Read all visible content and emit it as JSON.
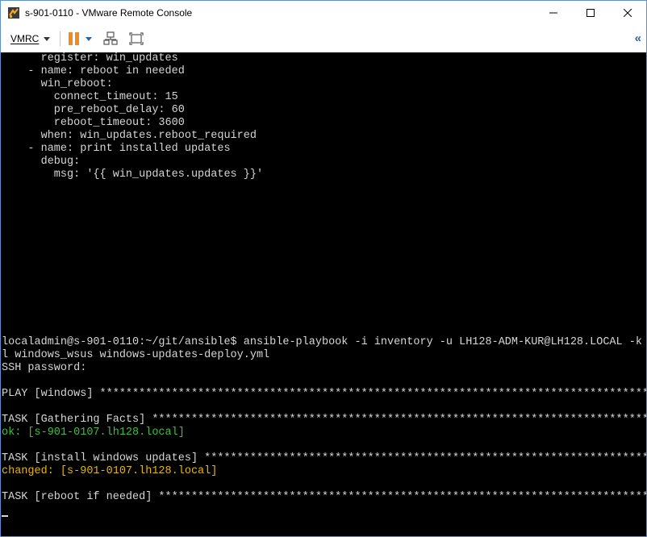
{
  "window": {
    "title": "s-901-0110 - VMware Remote Console",
    "controls": {
      "minimize": "—",
      "maximize": "☐",
      "close": "✕"
    }
  },
  "toolbar": {
    "vmrc_label": "VMRC",
    "collapse_label": "«"
  },
  "console": {
    "lines": [
      {
        "text": "      register: win_updates",
        "color": "default"
      },
      {
        "text": "    - name: reboot in needed",
        "color": "default"
      },
      {
        "text": "      win_reboot:",
        "color": "default"
      },
      {
        "text": "        connect_timeout: 15",
        "color": "default"
      },
      {
        "text": "        pre_reboot_delay: 60",
        "color": "default"
      },
      {
        "text": "        reboot_timeout: 3600",
        "color": "default"
      },
      {
        "text": "      when: win_updates.reboot_required",
        "color": "default"
      },
      {
        "text": "    - name: print installed updates",
        "color": "default"
      },
      {
        "text": "      debug:",
        "color": "default"
      },
      {
        "text": "        msg: '{{ win_updates.updates }}'",
        "color": "default"
      },
      {
        "text": "",
        "color": "default"
      },
      {
        "text": "",
        "color": "default"
      },
      {
        "text": "",
        "color": "default"
      },
      {
        "text": "",
        "color": "default"
      },
      {
        "text": "",
        "color": "default"
      },
      {
        "text": "",
        "color": "default"
      },
      {
        "text": "",
        "color": "default"
      },
      {
        "text": "",
        "color": "default"
      },
      {
        "text": "",
        "color": "default"
      },
      {
        "text": "",
        "color": "default"
      },
      {
        "text": "",
        "color": "default"
      },
      {
        "text": "",
        "color": "default"
      },
      {
        "text": "localadmin@s-901-0110:~/git/ansible$ ansible-playbook -i inventory -u LH128-ADM-KUR@LH128.LOCAL -k -",
        "color": "default"
      },
      {
        "text": "l windows_wsus windows-updates-deploy.yml",
        "color": "default"
      },
      {
        "text": "SSH password:",
        "color": "default"
      },
      {
        "text": "",
        "color": "default"
      },
      {
        "text": "PLAY [windows] ******************************************************************************************",
        "color": "default"
      },
      {
        "text": "",
        "color": "default"
      },
      {
        "text": "TASK [Gathering Facts] **********************************************************************************",
        "color": "default"
      },
      {
        "text": "ok: [s-901-0107.lh128.local]",
        "color": "green"
      },
      {
        "text": "",
        "color": "default"
      },
      {
        "text": "TASK [install windows updates] **************************************************************************",
        "color": "default"
      },
      {
        "text": "changed: [s-901-0107.lh128.local]",
        "color": "yellow"
      },
      {
        "text": "",
        "color": "default"
      },
      {
        "text": "TASK [reboot if needed] *********************************************************************************",
        "color": "default"
      }
    ]
  }
}
